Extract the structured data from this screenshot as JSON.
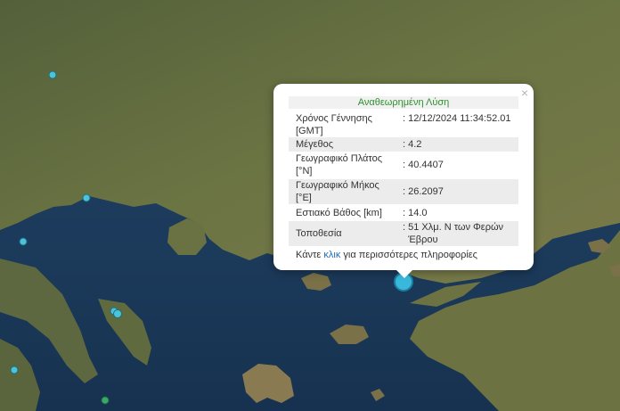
{
  "popup": {
    "title": "Αναθεωρημένη Λύση",
    "close_symbol": "×",
    "rows": [
      {
        "label": "Χρόνος Γέννησης",
        "label2": "[GMT]",
        "value": ": 12/12/2024 11:34:52.01",
        "value2": ""
      },
      {
        "label": "Μέγεθος",
        "label2": "",
        "value": ": 4.2",
        "value2": ""
      },
      {
        "label": "Γεωγραφικό Πλάτος",
        "label2": "[°N]",
        "value": ": 40.4407",
        "value2": ""
      },
      {
        "label": "Γεωγραφικό Μήκος",
        "label2": "[°E]",
        "value": ": 26.2097",
        "value2": ""
      },
      {
        "label": "Εστιακό Βάθος [km]",
        "label2": "",
        "value": ": 14.0",
        "value2": ""
      },
      {
        "label": "Τοποθεσία",
        "label2": "",
        "value": ": 51 Χλμ. Ν των Φερών",
        "value2": "Έβρου"
      }
    ],
    "more_prefix": "Κάντε ",
    "more_link": "κλικ",
    "more_suffix": " για περισσότερες πληροφορίες"
  },
  "colors": {
    "sea": "#1e3a5a",
    "land": "#5f6a3c",
    "marker_main": "#3ab8dc",
    "marker_other": "#4cc3d9",
    "title_green": "#2f8f2f",
    "link": "#1f6fb7"
  },
  "icons": {
    "close": "close-icon",
    "epicenter": "epicenter-marker-icon",
    "station": "earthquake-marker-icon"
  }
}
